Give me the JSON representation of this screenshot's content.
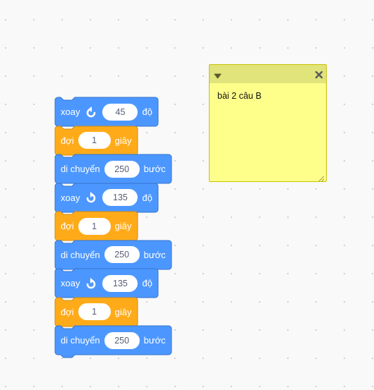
{
  "colors": {
    "motion": "#4c97ff",
    "motion_stroke": "#3373cc",
    "control": "#ffab19",
    "control_stroke": "#cf8b17",
    "note_body": "#feff8a",
    "note_header": "#e0e47a"
  },
  "blocks": [
    {
      "kind": "turn",
      "category": "motion",
      "parts": [
        "xoay",
        "{icon:rotate-left}",
        "{value}",
        "độ"
      ],
      "value": "45"
    },
    {
      "kind": "wait",
      "category": "control",
      "parts": [
        "đợi",
        "{value}",
        "giây"
      ],
      "value": "1"
    },
    {
      "kind": "move",
      "category": "motion",
      "parts": [
        "di chuyển",
        "{value}",
        "bước"
      ],
      "value": "250"
    },
    {
      "kind": "turn",
      "category": "motion",
      "parts": [
        "xoay",
        "{icon:rotate-right}",
        "{value}",
        "độ"
      ],
      "value": "135"
    },
    {
      "kind": "wait",
      "category": "control",
      "parts": [
        "đợi",
        "{value}",
        "giây"
      ],
      "value": "1"
    },
    {
      "kind": "move",
      "category": "motion",
      "parts": [
        "di chuyển",
        "{value}",
        "bước"
      ],
      "value": "250"
    },
    {
      "kind": "turn",
      "category": "motion",
      "parts": [
        "xoay",
        "{icon:rotate-right}",
        "{value}",
        "độ"
      ],
      "value": "135"
    },
    {
      "kind": "wait",
      "category": "control",
      "parts": [
        "đợi",
        "{value}",
        "giây"
      ],
      "value": "1"
    },
    {
      "kind": "move",
      "category": "motion",
      "parts": [
        "di chuyển",
        "{value}",
        "bước"
      ],
      "value": "250"
    }
  ],
  "note": {
    "text": "bài 2 câu B",
    "collapse_icon": "triangle-down-icon",
    "close_icon": "close-icon",
    "resize_icon": "resize-handle-icon"
  }
}
